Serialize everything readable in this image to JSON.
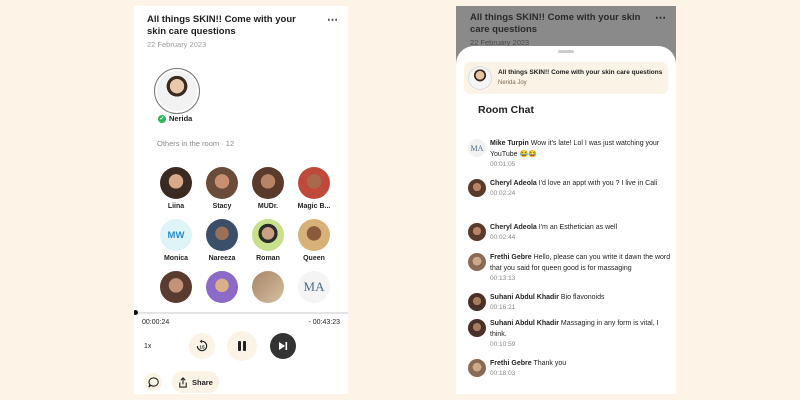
{
  "room": {
    "title": "All things SKIN!! Come with your skin care questions",
    "date": "22 February 2023",
    "more_icon": "⋯"
  },
  "host": {
    "name": "Nerida"
  },
  "others": {
    "label": "Others in the room · 12"
  },
  "members": [
    {
      "name": "Liina",
      "color": "#3a2a22"
    },
    {
      "name": "Stacy",
      "color": "#6b4b39"
    },
    {
      "name": "MUDr.",
      "color": "#5a3a2a"
    },
    {
      "name": "Magic B...",
      "color": "#7a4a34"
    },
    {
      "name": "Monica",
      "initials": "MW"
    },
    {
      "name": "Nareeza",
      "color": "#3b4e6a"
    },
    {
      "name": "Roman",
      "color": "#c8e08a"
    },
    {
      "name": "Queen",
      "color": "#b07a44"
    },
    {
      "name": "",
      "color": "#5a3b30"
    },
    {
      "name": "",
      "color": "#8b6ac8"
    },
    {
      "name": "",
      "color": "#a58468"
    },
    {
      "name": "",
      "initials": "MA"
    }
  ],
  "player": {
    "elapsed": "00:00:24",
    "remaining": "- 00:43:23",
    "speed": "1x",
    "progress_fraction": 0.01,
    "share_label": "Share"
  },
  "chat_panel": {
    "room_title": "All things SKIN!! Come with your skin care questions",
    "room_host": "Nerida Joy",
    "heading": "Room Chat",
    "messages": [
      {
        "author": "Mike Turpin",
        "text": "Wow it's late! Lol I was just watching your YouTube 😂😂",
        "time": "00:01:05",
        "avatar": "MA"
      },
      {
        "author": "Cheryl Adeola",
        "text": "I'd love an appt with you ? I live in Cali",
        "time": "00:02:24",
        "color": "#5a3a2a"
      },
      {
        "author": "Cheryl Adeola",
        "text": "I'm an Esthetician as well",
        "time": "00:02:44",
        "color": "#5a3a2a"
      },
      {
        "author": "Frethi Gebre",
        "text": "Hello, please can you write it dawn the word that you said for queen good is for massaging",
        "time": "00:13:13",
        "color": "#8a6a55"
      },
      {
        "author": "Suhani Abdul Khadir",
        "text": "Bio flavonoids",
        "time": "00:16:21",
        "color": "#4a3028"
      },
      {
        "author": "Suhani Abdul Khadir",
        "text": "Massaging in any form is vital, I think.",
        "time": "00:10:59",
        "color": "#4a3028"
      },
      {
        "author": "Frethi Gebre",
        "text": "Thank you",
        "time": "00:18:03",
        "color": "#8a6a55"
      }
    ]
  },
  "colors": {
    "background": "#fdf4e7",
    "accent_cream": "#fbf3e5",
    "online_green": "#2bb55d"
  }
}
